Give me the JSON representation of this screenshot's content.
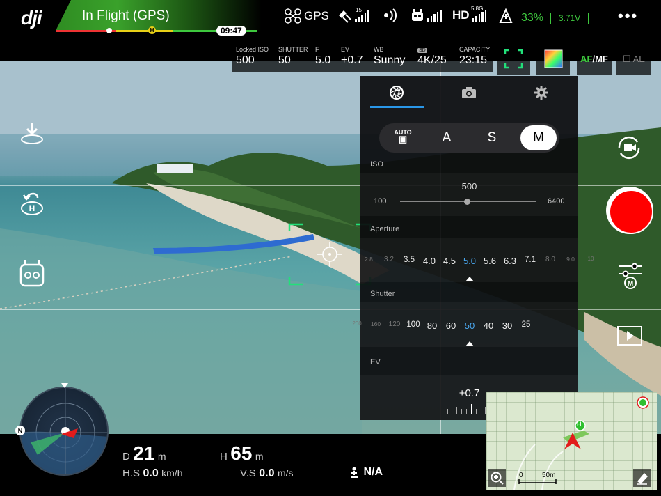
{
  "top_bar": {
    "logo": "dji",
    "flight_status": "In Flight (GPS)",
    "home_marker": "H",
    "flight_time": "09:47",
    "gps_label": "GPS",
    "satellite_count": "15",
    "hd_label": "HD",
    "hd_band": "5.8G",
    "battery_percent": "33%",
    "battery_voltage": "3.71V",
    "more_icon": "more-dots-icon"
  },
  "camera_settings": {
    "iso": {
      "label": "Locked ISO",
      "value": "500"
    },
    "shutter": {
      "label": "SHUTTER",
      "value": "50"
    },
    "aperture": {
      "label": "F",
      "value": "5.0"
    },
    "ev": {
      "label": "EV",
      "value": "+0.7"
    },
    "wb": {
      "label": "WB",
      "value": "Sunny"
    },
    "resolution": {
      "label": "SD",
      "value": "4K/25"
    },
    "capacity": {
      "label": "CAPACITY",
      "value": "23:15"
    },
    "af_label": "AF",
    "mf_label": "MF",
    "ae_label": "AE"
  },
  "panel": {
    "tabs": [
      "aperture-icon",
      "camera-icon",
      "gear-icon"
    ],
    "modes": [
      {
        "label": "AUTO"
      },
      {
        "label": "A"
      },
      {
        "label": "S"
      },
      {
        "label": "M"
      }
    ],
    "selected_mode": "M",
    "iso": {
      "title": "ISO",
      "value": "500",
      "min": "100",
      "max": "6400",
      "position": 0.47
    },
    "aperture": {
      "title": "Aperture",
      "values": [
        "2.8",
        "3.2",
        "3.5",
        "4.0",
        "4.5",
        "5.0",
        "5.6",
        "6.3",
        "7.1",
        "8.0",
        "9.0",
        "10"
      ],
      "selected": "5.0"
    },
    "shutter": {
      "title": "Shutter",
      "values": [
        "200",
        "160",
        "120",
        "100",
        "80",
        "60",
        "50",
        "40",
        "30",
        "25"
      ],
      "selected": "50"
    },
    "ev": {
      "title": "EV",
      "value": "+0.7"
    }
  },
  "telemetry": {
    "distance_label": "D",
    "distance_value": "21",
    "distance_unit": "m",
    "height_label": "H",
    "height_value": "65",
    "height_unit": "m",
    "hs_label": "H.S",
    "hs_value": "0.0",
    "hs_unit": "km/h",
    "vs_label": "V.S",
    "vs_value": "0.0",
    "vs_unit": "m/s",
    "vps_value": "N/A"
  },
  "radar": {
    "north_label": "N"
  },
  "map": {
    "scale_zero": "0",
    "scale_label": "50m",
    "home_marker": "H"
  },
  "colors": {
    "accent_green": "#3ec83e",
    "record_red": "#ff0000",
    "tab_underline": "#2a97e8",
    "selected_value": "#4aa8f0",
    "focus_box": "#22e07a"
  }
}
